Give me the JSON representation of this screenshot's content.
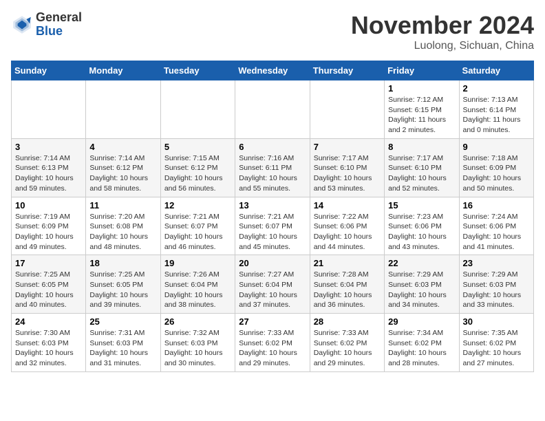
{
  "header": {
    "logo_line1": "General",
    "logo_line2": "Blue",
    "month_title": "November 2024",
    "location": "Luolong, Sichuan, China"
  },
  "weekdays": [
    "Sunday",
    "Monday",
    "Tuesday",
    "Wednesday",
    "Thursday",
    "Friday",
    "Saturday"
  ],
  "weeks": [
    [
      {
        "day": "",
        "info": ""
      },
      {
        "day": "",
        "info": ""
      },
      {
        "day": "",
        "info": ""
      },
      {
        "day": "",
        "info": ""
      },
      {
        "day": "",
        "info": ""
      },
      {
        "day": "1",
        "info": "Sunrise: 7:12 AM\nSunset: 6:15 PM\nDaylight: 11 hours and 2 minutes."
      },
      {
        "day": "2",
        "info": "Sunrise: 7:13 AM\nSunset: 6:14 PM\nDaylight: 11 hours and 0 minutes."
      }
    ],
    [
      {
        "day": "3",
        "info": "Sunrise: 7:14 AM\nSunset: 6:13 PM\nDaylight: 10 hours and 59 minutes."
      },
      {
        "day": "4",
        "info": "Sunrise: 7:14 AM\nSunset: 6:12 PM\nDaylight: 10 hours and 58 minutes."
      },
      {
        "day": "5",
        "info": "Sunrise: 7:15 AM\nSunset: 6:12 PM\nDaylight: 10 hours and 56 minutes."
      },
      {
        "day": "6",
        "info": "Sunrise: 7:16 AM\nSunset: 6:11 PM\nDaylight: 10 hours and 55 minutes."
      },
      {
        "day": "7",
        "info": "Sunrise: 7:17 AM\nSunset: 6:10 PM\nDaylight: 10 hours and 53 minutes."
      },
      {
        "day": "8",
        "info": "Sunrise: 7:17 AM\nSunset: 6:10 PM\nDaylight: 10 hours and 52 minutes."
      },
      {
        "day": "9",
        "info": "Sunrise: 7:18 AM\nSunset: 6:09 PM\nDaylight: 10 hours and 50 minutes."
      }
    ],
    [
      {
        "day": "10",
        "info": "Sunrise: 7:19 AM\nSunset: 6:09 PM\nDaylight: 10 hours and 49 minutes."
      },
      {
        "day": "11",
        "info": "Sunrise: 7:20 AM\nSunset: 6:08 PM\nDaylight: 10 hours and 48 minutes."
      },
      {
        "day": "12",
        "info": "Sunrise: 7:21 AM\nSunset: 6:07 PM\nDaylight: 10 hours and 46 minutes."
      },
      {
        "day": "13",
        "info": "Sunrise: 7:21 AM\nSunset: 6:07 PM\nDaylight: 10 hours and 45 minutes."
      },
      {
        "day": "14",
        "info": "Sunrise: 7:22 AM\nSunset: 6:06 PM\nDaylight: 10 hours and 44 minutes."
      },
      {
        "day": "15",
        "info": "Sunrise: 7:23 AM\nSunset: 6:06 PM\nDaylight: 10 hours and 43 minutes."
      },
      {
        "day": "16",
        "info": "Sunrise: 7:24 AM\nSunset: 6:06 PM\nDaylight: 10 hours and 41 minutes."
      }
    ],
    [
      {
        "day": "17",
        "info": "Sunrise: 7:25 AM\nSunset: 6:05 PM\nDaylight: 10 hours and 40 minutes."
      },
      {
        "day": "18",
        "info": "Sunrise: 7:25 AM\nSunset: 6:05 PM\nDaylight: 10 hours and 39 minutes."
      },
      {
        "day": "19",
        "info": "Sunrise: 7:26 AM\nSunset: 6:04 PM\nDaylight: 10 hours and 38 minutes."
      },
      {
        "day": "20",
        "info": "Sunrise: 7:27 AM\nSunset: 6:04 PM\nDaylight: 10 hours and 37 minutes."
      },
      {
        "day": "21",
        "info": "Sunrise: 7:28 AM\nSunset: 6:04 PM\nDaylight: 10 hours and 36 minutes."
      },
      {
        "day": "22",
        "info": "Sunrise: 7:29 AM\nSunset: 6:03 PM\nDaylight: 10 hours and 34 minutes."
      },
      {
        "day": "23",
        "info": "Sunrise: 7:29 AM\nSunset: 6:03 PM\nDaylight: 10 hours and 33 minutes."
      }
    ],
    [
      {
        "day": "24",
        "info": "Sunrise: 7:30 AM\nSunset: 6:03 PM\nDaylight: 10 hours and 32 minutes."
      },
      {
        "day": "25",
        "info": "Sunrise: 7:31 AM\nSunset: 6:03 PM\nDaylight: 10 hours and 31 minutes."
      },
      {
        "day": "26",
        "info": "Sunrise: 7:32 AM\nSunset: 6:03 PM\nDaylight: 10 hours and 30 minutes."
      },
      {
        "day": "27",
        "info": "Sunrise: 7:33 AM\nSunset: 6:02 PM\nDaylight: 10 hours and 29 minutes."
      },
      {
        "day": "28",
        "info": "Sunrise: 7:33 AM\nSunset: 6:02 PM\nDaylight: 10 hours and 29 minutes."
      },
      {
        "day": "29",
        "info": "Sunrise: 7:34 AM\nSunset: 6:02 PM\nDaylight: 10 hours and 28 minutes."
      },
      {
        "day": "30",
        "info": "Sunrise: 7:35 AM\nSunset: 6:02 PM\nDaylight: 10 hours and 27 minutes."
      }
    ]
  ]
}
